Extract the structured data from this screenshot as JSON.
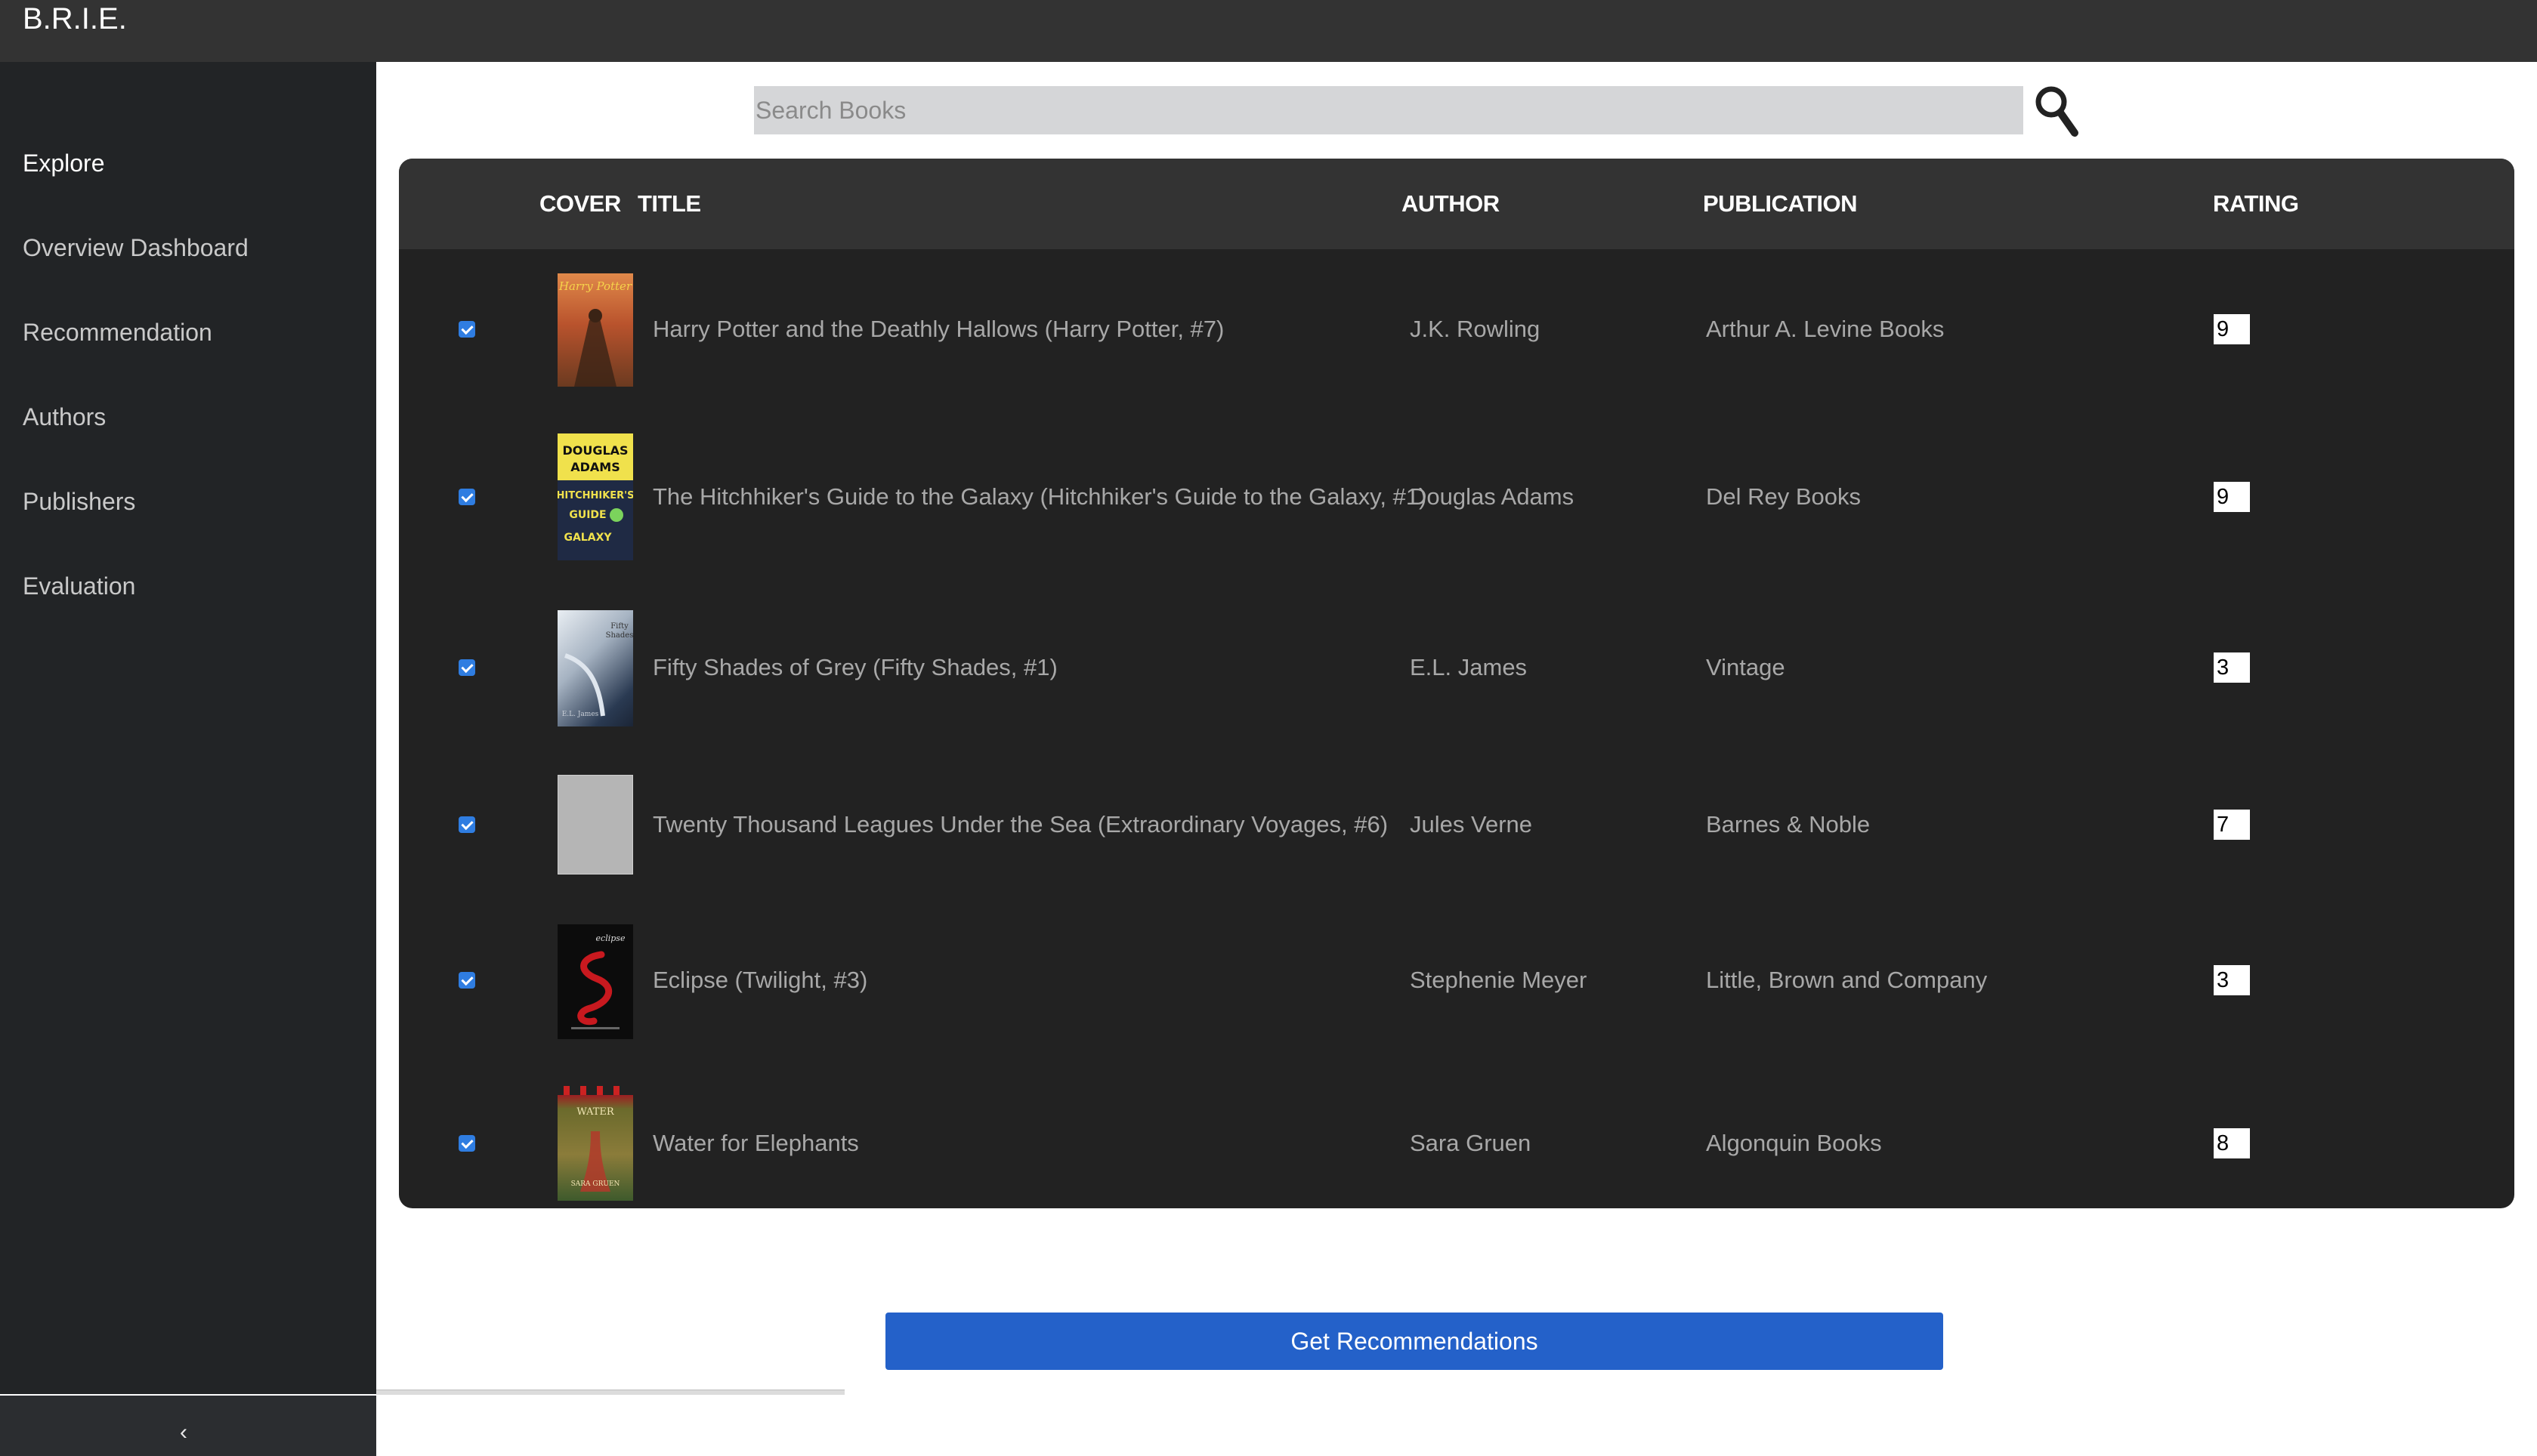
{
  "app": {
    "brand": "B.R.I.E."
  },
  "sidebar": {
    "items": [
      {
        "label": "Explore",
        "active": true
      },
      {
        "label": "Overview Dashboard"
      },
      {
        "label": "Recommendation"
      },
      {
        "label": "Authors"
      },
      {
        "label": "Publishers"
      },
      {
        "label": "Evaluation"
      }
    ],
    "collapse_icon": "chevron-left-icon"
  },
  "search": {
    "placeholder": "Search Books",
    "icon": "search-icon"
  },
  "table": {
    "headers": {
      "cover": "COVER",
      "title": "TITLE",
      "author": "AUTHOR",
      "publication": "PUBLICATION",
      "rating": "RATING"
    },
    "rows": [
      {
        "checked": true,
        "title": "Harry Potter and the Deathly Hallows (Harry Potter, #7)",
        "author": "J.K. Rowling",
        "publication": "Arthur A. Levine Books",
        "rating": "9",
        "cover_text": "Harry Potter"
      },
      {
        "checked": true,
        "title": "The Hitchhiker's Guide to the Galaxy (Hitchhiker's Guide to the Galaxy, #1)",
        "author": "Douglas Adams",
        "publication": "Del Rey Books",
        "rating": "9",
        "cover_text": "DOUGLAS ADAMS THE HITCHHIKER'S GUIDE TO THE GALAXY"
      },
      {
        "checked": true,
        "title": "Fifty Shades of Grey (Fifty Shades, #1)",
        "author": "E.L. James",
        "publication": "Vintage",
        "rating": "3",
        "cover_text": "Fifty Shades of Grey"
      },
      {
        "checked": true,
        "title": "Twenty Thousand Leagues Under the Sea (Extraordinary Voyages, #6)",
        "author": "Jules Verne",
        "publication": "Barnes & Noble",
        "rating": "7",
        "cover_text": ""
      },
      {
        "checked": true,
        "title": "Eclipse (Twilight, #3)",
        "author": "Stephenie Meyer",
        "publication": "Little, Brown and Company",
        "rating": "3",
        "cover_text": "eclipse"
      },
      {
        "checked": true,
        "title": "Water for Elephants",
        "author": "Sara Gruen",
        "publication": "Algonquin Books",
        "rating": "8",
        "cover_text": "WATER FOR ELEPHANTS"
      }
    ]
  },
  "actions": {
    "recommend_label": "Get Recommendations"
  },
  "colors": {
    "topbar": "#333333",
    "sidebar": "#222426",
    "table": "#222222",
    "accent": "#2461c9"
  }
}
